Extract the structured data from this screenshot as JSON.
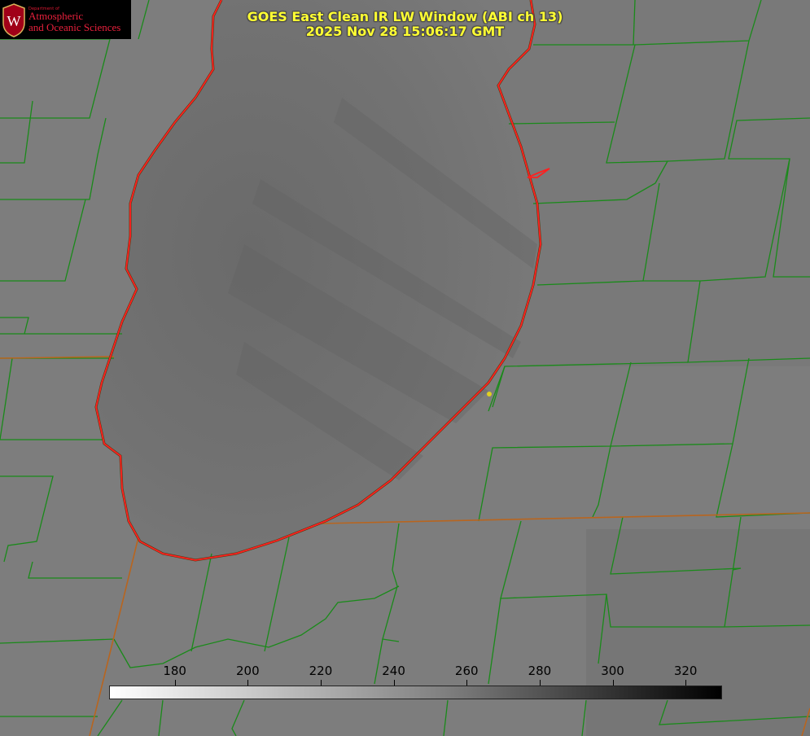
{
  "logo": {
    "department": "Department of",
    "line1": "Atmospheric",
    "line2": "and Oceanic Sciences",
    "emblem_letter": "W"
  },
  "title": {
    "line1": "GOES East Clean IR LW Window (ABI ch 13)",
    "line2": "2025 Nov 28 15:06:17 GMT"
  },
  "colorbar": {
    "tick_labels": [
      "180",
      "200",
      "220",
      "240",
      "260",
      "280",
      "300",
      "320"
    ],
    "ticks": [
      180,
      200,
      220,
      240,
      260,
      280,
      300,
      320
    ],
    "range": [
      162,
      330
    ],
    "colormap": "white-to-black greyscale"
  },
  "map": {
    "feature": "Lake Michigan (southern basin)",
    "shoreline_color": "#ff2020",
    "county_border_color": "#1a8a1a",
    "state_border_color": "#c06020",
    "marker_color": "#e0d020"
  }
}
